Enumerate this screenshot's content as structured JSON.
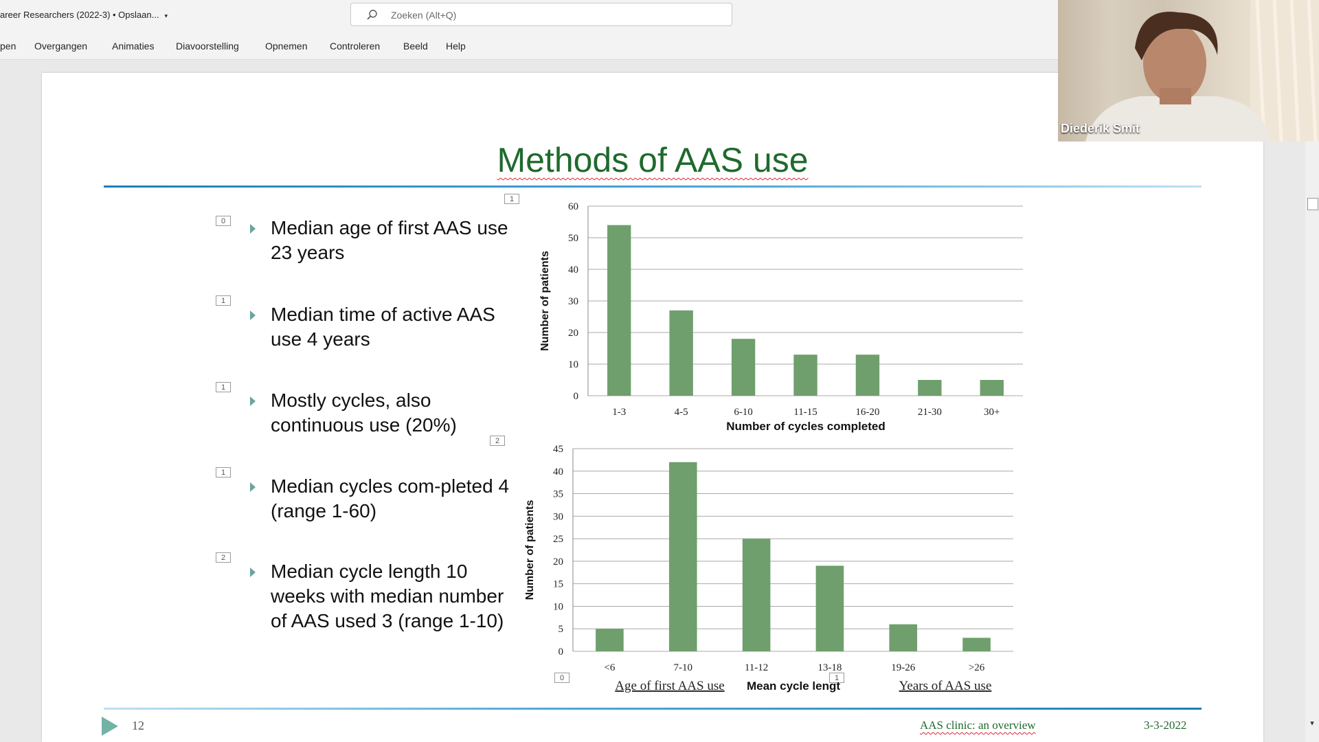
{
  "app": {
    "doc_title": "areer Researchers (2022-3) • Opslaan...",
    "search_placeholder": "Zoeken (Alt+Q)",
    "ribbon_tabs": [
      "pen",
      "Overgangen",
      "Animaties",
      "Diavoorstelling",
      "Opnemen",
      "Controleren",
      "Beeld",
      "Help"
    ]
  },
  "video": {
    "participant_name": "Diederik Smit"
  },
  "slide": {
    "title": "Methods of AAS use",
    "bullets": [
      {
        "tag": "0",
        "text": "Median age of first AAS use 23 years"
      },
      {
        "tag": "1",
        "text": "Median time of active AAS use 4 years"
      },
      {
        "tag": "1",
        "text": "Mostly cycles, also continuous use (20%)"
      },
      {
        "tag": "1",
        "text": "Median cycles com-pleted 4 (range 1-60)"
      },
      {
        "tag": "2",
        "text": "Median cycle length 10 weeks with median number of AAS used 3 (range 1-10)"
      }
    ],
    "chart_tags": {
      "top_chart": "1",
      "between": "2",
      "bottom_left": "0",
      "bottom_mid": "1"
    },
    "footer": {
      "slide_number": "12",
      "center": "AAS clinic: an overview",
      "date": "3-3-2022"
    }
  },
  "colors": {
    "bar": "#6f9f6c",
    "title": "#1f6a2d",
    "accent_rule": "#1a7fb9"
  },
  "chart_data": [
    {
      "type": "bar",
      "categories": [
        "1-3",
        "4-5",
        "6-10",
        "11-15",
        "16-20",
        "21-30",
        "30+"
      ],
      "values": [
        54,
        27,
        18,
        13,
        13,
        5,
        5
      ],
      "xlabel": "Number of cycles completed",
      "ylabel": "Number of patients",
      "ylim": [
        0,
        60
      ],
      "yticks": [
        0,
        10,
        20,
        30,
        40,
        50,
        60
      ],
      "grid": true
    },
    {
      "type": "bar",
      "categories": [
        "<6",
        "7-10",
        "11-12",
        "13-18",
        "19-26",
        ">26"
      ],
      "values": [
        5,
        42,
        25,
        19,
        6,
        3
      ],
      "xlabel": "Mean cycle lengt",
      "ylabel": "Number of patients",
      "ylim": [
        0,
        45
      ],
      "yticks": [
        0,
        5,
        10,
        15,
        20,
        25,
        30,
        35,
        40,
        45
      ],
      "grid": true,
      "annotations": [
        "Age of first AAS use",
        "Years of AAS use"
      ]
    }
  ]
}
